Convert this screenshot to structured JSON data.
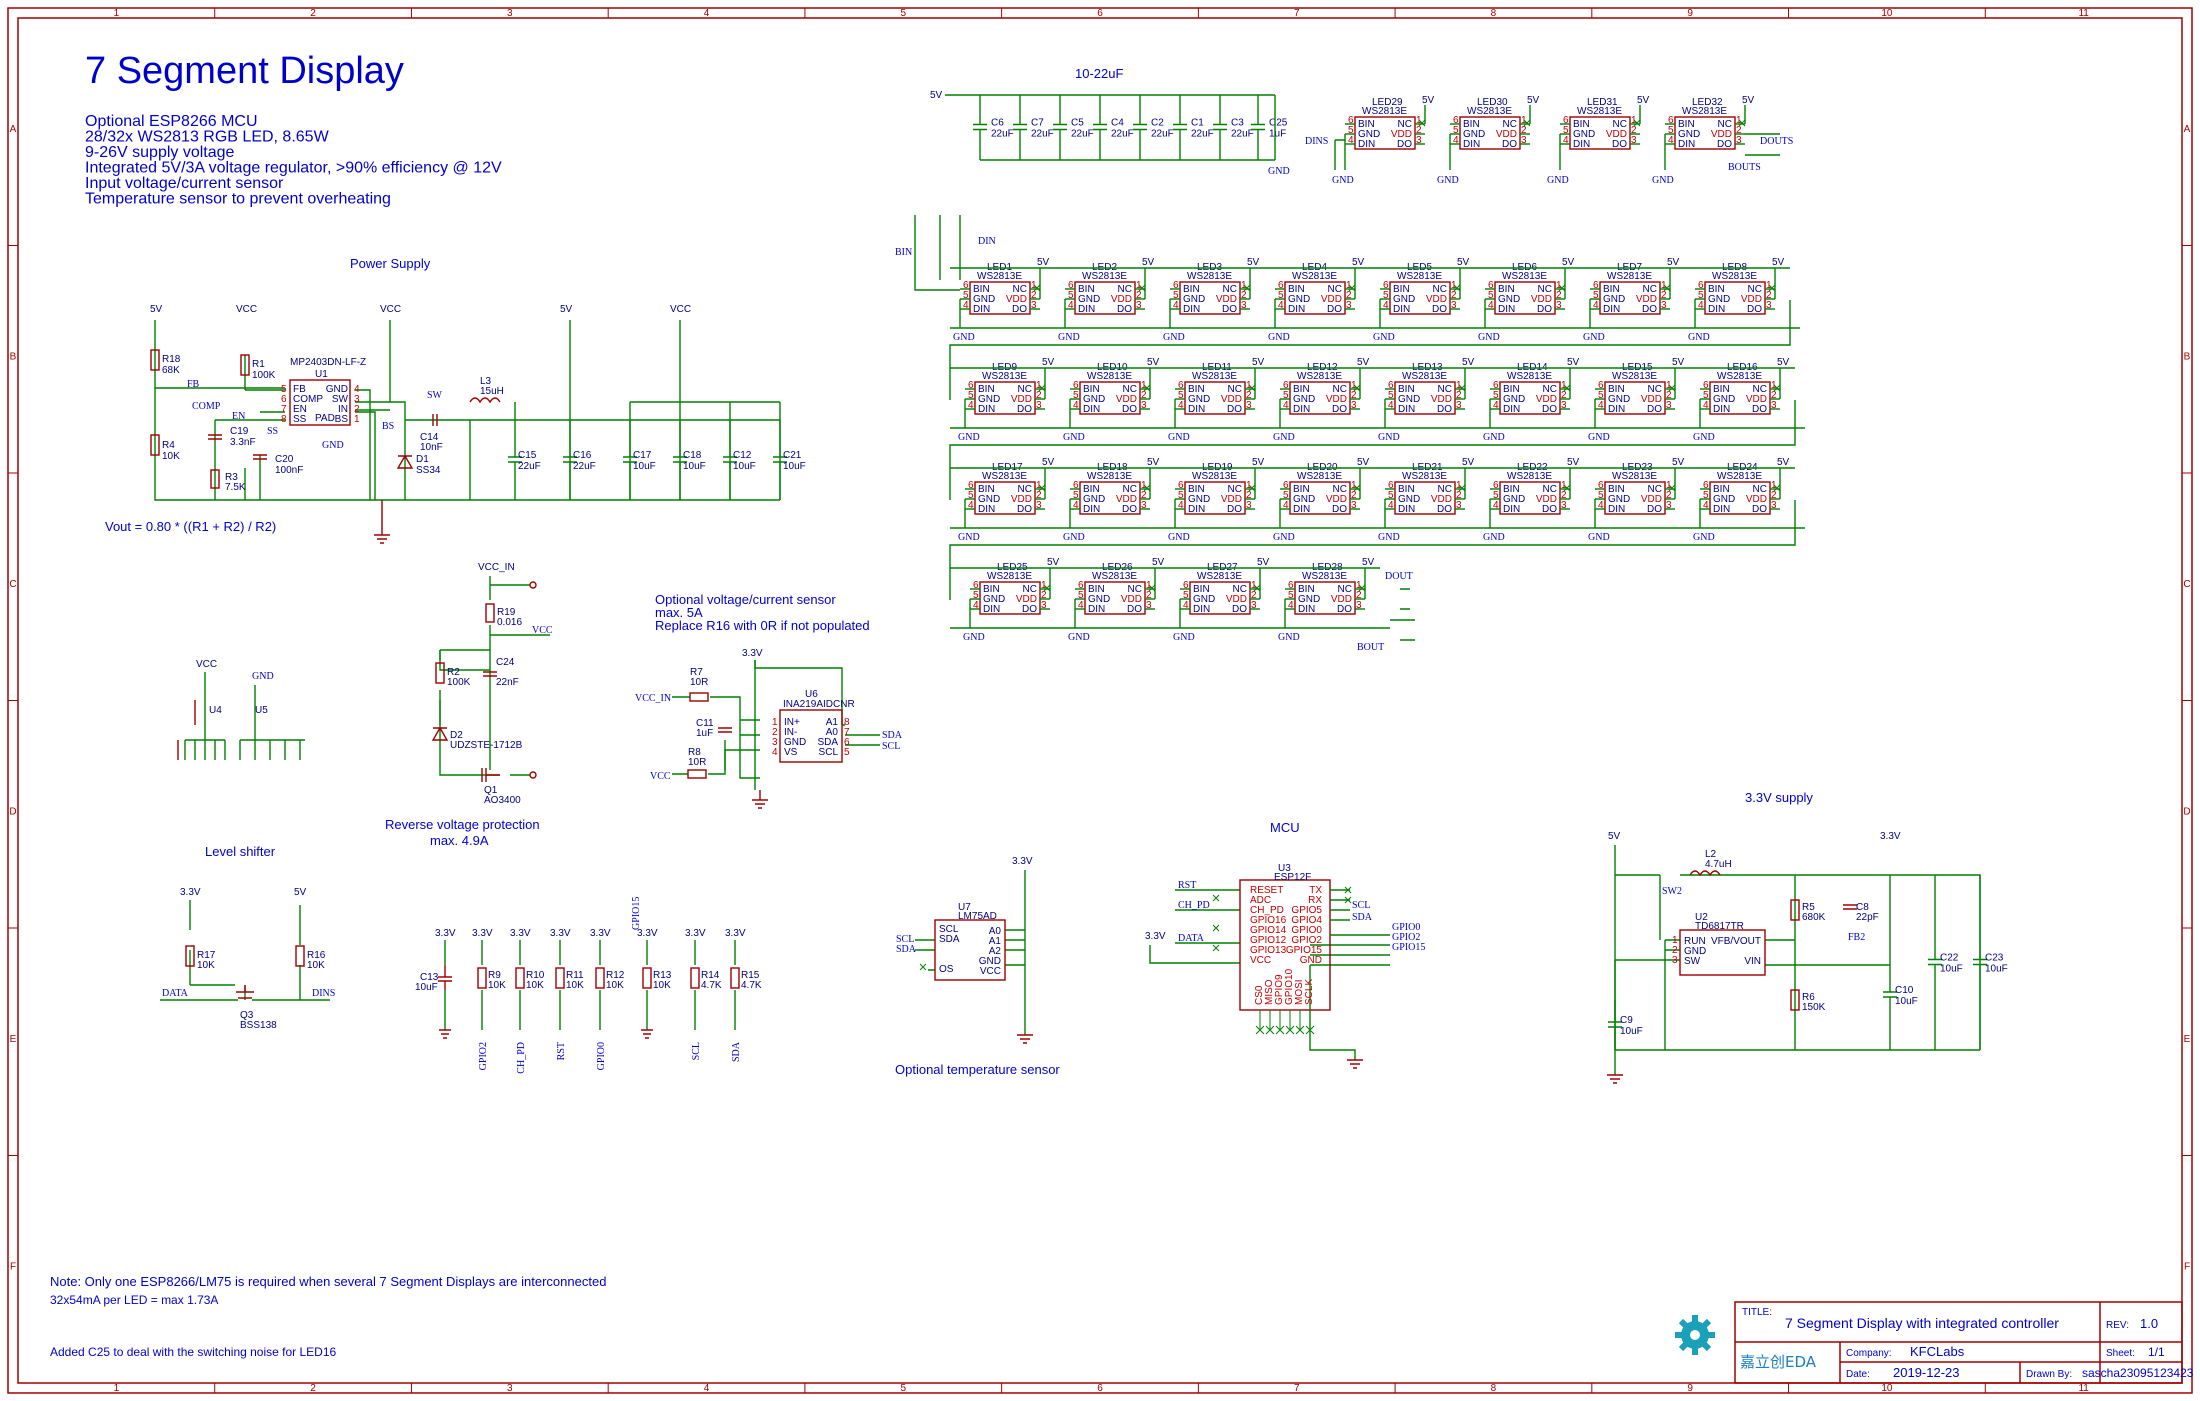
{
  "header": {
    "title": "7 Segment Display",
    "notes": [
      "Optional ESP8266 MCU",
      "28/32x WS2813 RGB LED, 8.65W",
      "9-26V supply voltage",
      "Integrated 5V/3A voltage regulator, >90% efficiency @ 12V",
      "Input voltage/current sensor",
      "Temperature sensor to prevent overheating"
    ]
  },
  "zones": {
    "columns": [
      "1",
      "2",
      "3",
      "4",
      "5",
      "6",
      "7",
      "8",
      "9",
      "10",
      "11"
    ],
    "rows": [
      "A",
      "B",
      "C",
      "D",
      "E",
      "F"
    ]
  },
  "sections": {
    "power_supply": "Power Supply",
    "vout_formula": "Vout = 0.80 * ((R1 + R2) / R2)",
    "reverse_protection": [
      "Reverse voltage protection",
      "max. 4.9A"
    ],
    "level_shifter": "Level shifter",
    "sensor_note": [
      "Optional voltage/current sensor",
      "max. 5A",
      "Replace R16 with 0R if not populated"
    ],
    "mcu": "MCU",
    "temp_sensor": "Optional temperature sensor",
    "supply_33": "3.3V supply",
    "cap_bank": "10-22uF"
  },
  "nets": {
    "v5": "5V",
    "vcc": "VCC",
    "v33": "3.3V",
    "gnd": "GND",
    "vcc_in": "VCC_IN",
    "din": "DIN",
    "bin": "BIN",
    "dout": "DOUT",
    "bout": "BOUT",
    "dins": "DINS",
    "douts": "DOUTS",
    "bouts": "BOUTS",
    "data": "DATA",
    "scl": "SCL",
    "sda": "SDA",
    "rst": "RST",
    "ch_pd": "CH_PD",
    "gpio0": "GPIO0",
    "gpio2": "GPIO2",
    "gpio15": "GPIO15",
    "fb": "FB",
    "comp": "COMP",
    "en": "EN",
    "ss": "SS",
    "sw": "SW",
    "bs": "BS",
    "sw2": "SW2",
    "fb2": "FB2"
  },
  "caps_top": [
    {
      "ref": "C6",
      "val": "22uF"
    },
    {
      "ref": "C7",
      "val": "22uF"
    },
    {
      "ref": "C5",
      "val": "22uF"
    },
    {
      "ref": "C4",
      "val": "22uF"
    },
    {
      "ref": "C2",
      "val": "22uF"
    },
    {
      "ref": "C1",
      "val": "22uF"
    },
    {
      "ref": "C3",
      "val": "22uF"
    },
    {
      "ref": "C25",
      "val": "1uF"
    }
  ],
  "led_part": "WS2813E",
  "led_pins": [
    "BIN",
    "GND",
    "DIN",
    "NC",
    "VDD",
    "DO"
  ],
  "leds_top": [
    "LED29",
    "LED30",
    "LED31",
    "LED32"
  ],
  "led_rows": [
    [
      "LED1",
      "LED2",
      "LED3",
      "LED4",
      "LED5",
      "LED6",
      "LED7",
      "LED8"
    ],
    [
      "LED9",
      "LED10",
      "LED11",
      "LED12",
      "LED13",
      "LED14",
      "LED15",
      "LED16"
    ],
    [
      "LED17",
      "LED18",
      "LED19",
      "LED20",
      "LED21",
      "LED22",
      "LED23",
      "LED24"
    ],
    [
      "LED25",
      "LED26",
      "LED27",
      "LED28"
    ]
  ],
  "power_parts": {
    "u1": {
      "ref": "U1",
      "part": "MP2403DN-LF-Z",
      "pins_left": [
        "FB",
        "COMP",
        "EN",
        "SS"
      ],
      "pins_right": [
        "GND",
        "SW",
        "IN",
        "BS"
      ],
      "pad": "PAD"
    },
    "r18": {
      "ref": "R18",
      "val": "68K"
    },
    "r4": {
      "ref": "R4",
      "val": "10K"
    },
    "r1": {
      "ref": "R1",
      "val": "100K"
    },
    "c19": {
      "ref": "C19",
      "val": "3.3nF"
    },
    "r3": {
      "ref": "R3",
      "val": "7.5K"
    },
    "c20": {
      "ref": "C20",
      "val": "100nF"
    },
    "c14": {
      "ref": "C14",
      "val": "10nF"
    },
    "d1": {
      "ref": "D1",
      "val": "SS34"
    },
    "l3": {
      "ref": "L3",
      "val": "15uH"
    },
    "c15": {
      "ref": "C15",
      "val": "22uF"
    },
    "c16": {
      "ref": "C16",
      "val": "22uF"
    },
    "c17": {
      "ref": "C17",
      "val": "10uF"
    },
    "c18": {
      "ref": "C18",
      "val": "10uF"
    },
    "c12": {
      "ref": "C12",
      "val": "10uF"
    },
    "c21": {
      "ref": "C21",
      "val": "10uF"
    }
  },
  "protection_parts": {
    "r19": {
      "ref": "R19",
      "val": "0.016"
    },
    "r2": {
      "ref": "R2",
      "val": "100K"
    },
    "c24": {
      "ref": "C24",
      "val": "22nF"
    },
    "d2": {
      "ref": "D2",
      "val": "UDZSTE-1712B"
    },
    "q1": {
      "ref": "Q1",
      "val": "AO3400"
    }
  },
  "headers": {
    "u4": "U4",
    "u5": "U5"
  },
  "sensor_parts": {
    "r7": {
      "ref": "R7",
      "val": "10R"
    },
    "r8": {
      "ref": "R8",
      "val": "10R"
    },
    "c11": {
      "ref": "C11",
      "val": "1uF"
    },
    "u6": {
      "ref": "U6",
      "part": "INA219AIDCNR",
      "pins_left": [
        "IN+",
        "IN-",
        "GND",
        "VS"
      ],
      "pins_right": [
        "A1",
        "A0",
        "SDA",
        "SCL"
      ]
    }
  },
  "level_parts": {
    "r17": {
      "ref": "R17",
      "val": "10K"
    },
    "r16": {
      "ref": "R16",
      "val": "10K"
    },
    "q3": {
      "ref": "Q3",
      "val": "BSS138"
    }
  },
  "pullups": [
    {
      "ref": "C13",
      "val": "10uF",
      "net": ""
    },
    {
      "ref": "R9",
      "val": "10K",
      "net": "GPIO2"
    },
    {
      "ref": "R10",
      "val": "10K",
      "net": "CH_PD"
    },
    {
      "ref": "R11",
      "val": "10K",
      "net": "RST"
    },
    {
      "ref": "R12",
      "val": "10K",
      "net": "GPIO0"
    },
    {
      "ref": "R13",
      "val": "10K",
      "net": "GPIO15"
    },
    {
      "ref": "R14",
      "val": "4.7K",
      "net": "SCL"
    },
    {
      "ref": "R15",
      "val": "4.7K",
      "net": "SDA"
    }
  ],
  "temp_parts": {
    "u7": {
      "ref": "U7",
      "part": "LM75AD",
      "pins_left": [
        "SCL",
        "SDA",
        "OS"
      ],
      "pins_right": [
        "A0",
        "A1",
        "A2",
        "GND",
        "VCC"
      ]
    }
  },
  "mcu_parts": {
    "u3": {
      "ref": "U3",
      "part": "ESP12F",
      "pins_left": [
        "RESET",
        "ADC",
        "CH_PD",
        "GPIO16",
        "GPIO14",
        "GPIO12",
        "GPIO13",
        "VCC"
      ],
      "pins_right": [
        "TX",
        "RX",
        "GPIO5",
        "GPIO4",
        "GPIO0",
        "GPIO2",
        "GPIO15",
        "GND"
      ],
      "pins_bottom": [
        "CS0",
        "MISO",
        "GPIO9",
        "GPIO10",
        "MOSI",
        "SCLK"
      ]
    }
  },
  "supply_parts": {
    "l2": {
      "ref": "L2",
      "val": "4.7uH"
    },
    "r5": {
      "ref": "R5",
      "val": "680K"
    },
    "c8": {
      "ref": "C8",
      "val": "22pF"
    },
    "r6": {
      "ref": "R6",
      "val": "150K"
    },
    "u2": {
      "ref": "U2",
      "part": "TD6817TR",
      "pins_left": [
        "RUN",
        "GND",
        "SW"
      ],
      "pins_right": [
        "VFB/VOUT",
        "VIN"
      ]
    },
    "c9": {
      "ref": "C9",
      "val": "10uF"
    },
    "c10": {
      "ref": "C10",
      "val": "10uF"
    },
    "c22": {
      "ref": "C22",
      "val": "10uF"
    },
    "c23": {
      "ref": "C23",
      "val": "10uF"
    }
  },
  "footer_notes": [
    "Note: Only one ESP8266/LM75 is required when several 7 Segment Displays are interconnected",
    "32x54mA per LED = max 1.73A",
    "Added C25 to deal with the switching noise for LED16"
  ],
  "title_block": {
    "title_label": "TITLE:",
    "title": "7 Segment Display with integrated controller",
    "rev_label": "REV:",
    "rev": "1.0",
    "company_label": "Company:",
    "company": "KFCLabs",
    "sheet_label": "Sheet:",
    "sheet": "1/1",
    "date_label": "Date:",
    "date": "2019-12-23",
    "drawn_label": "Drawn By:",
    "drawn_by": "sascha23095123423",
    "logo_text": "嘉立创EDA"
  },
  "colors": {
    "frame": "#a00000",
    "wire": "#008000",
    "text": "#0000cc",
    "pin": "#c00000"
  }
}
